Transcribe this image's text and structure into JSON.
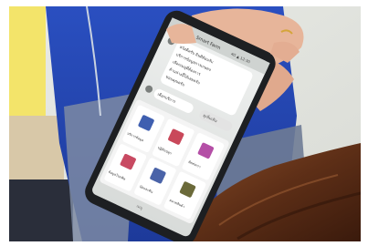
{
  "phone_screen": {
    "chat_title": "Smart Farm",
    "status_bar": "4G ▲ 12:30",
    "chat_lines": [
      "สวัสดีครับ ยินดีต้อนรับ",
      "บริการข้อมูลการเกษตร",
      "เลือกเมนูที่ต้องการ",
      "ด้านล่างนี้ได้เลยครับ",
      "ขอบคุณครับ"
    ],
    "user_reply": "เลือกบริการ",
    "reply_badge": "ดูเพิ่มเติม",
    "menu_tiles": [
      {
        "label": "บริการข้อมูล",
        "color": "#3f5fb0"
      },
      {
        "label": "ปฏิทินปลูก",
        "color": "#c9485a"
      },
      {
        "label": "ติดต่อเรา",
        "color": "#b44fa6"
      },
      {
        "label": "ข้อมูลโรคพืช",
        "color": "#c84a62"
      },
      {
        "label": "ปุ๋ยและดิน",
        "color": "#4a63a8"
      },
      {
        "label": "ตลาดสินค้า",
        "color": "#6b6a3a"
      }
    ],
    "footer_hint": "เมนู"
  }
}
